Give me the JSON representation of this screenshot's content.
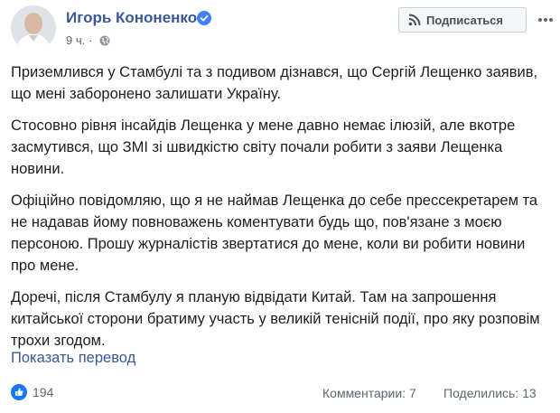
{
  "author": {
    "name": "Игорь Кононенко",
    "avatar_icon": "avatar-photo",
    "verified_icon": "verified-badge-icon"
  },
  "meta": {
    "time": "9 ч.",
    "separator": "·",
    "privacy_icon": "globe-icon"
  },
  "header": {
    "subscribe_label": "Подписаться",
    "subscribe_icon": "rss-icon",
    "more_icon": "more-dots-icon"
  },
  "post": {
    "paragraphs": [
      "Приземлився у Стамбулі та з подивом дізнався, що Сергій Лещенко заявив, що мені заборонено залишати Україну.",
      "Стосовно рівня інсайдів Лещенка у мене давно немає ілюзій, але вкотре засмутився, що ЗМІ зі швидкістю світу почали робити з заяви Лещенка новини.",
      "Офіційно повідомляю, що я не наймав Лещенка до себе прессекретарем та не надавав йому повноважень коментувати будь що, пов'язане з моєю персоною. Прошу журналістів звертатися до мене, коли ви робити новини про мене.",
      "Доречі, після Стамбулу я планую відвідати Китай. Там на запрошення китайської сторони братиму участь у великій тенісній події, про яку розповім трохи згодом."
    ],
    "translate_label": "Показать перевод"
  },
  "footer": {
    "likes_count": "194",
    "comments_label": "Комментарии: 7",
    "shares_label": "Поделились: 13"
  },
  "colors": {
    "link_blue": "#385898",
    "like_blue": "#1877f2",
    "verified_blue": "#4080ff",
    "muted_text": "#606770"
  }
}
